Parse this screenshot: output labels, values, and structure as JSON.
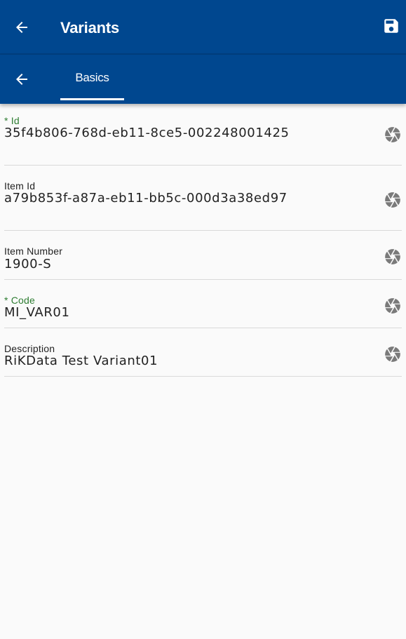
{
  "appbar": {
    "title": "Variants",
    "back_icon": "arrow-left-icon",
    "save_icon": "save-icon"
  },
  "tabbar": {
    "back_icon": "arrow-left-icon",
    "tabs": [
      {
        "label": "Basics",
        "active": true
      }
    ]
  },
  "fields": [
    {
      "label": "* Id",
      "required": true,
      "value": "35f4b806-768d-eb11-8ce5-002248001425",
      "icon": "camera-aperture-icon"
    },
    {
      "label": "Item Id",
      "required": false,
      "value": "a79b853f-a87a-eb11-bb5c-000d3a38ed97",
      "icon": "camera-aperture-icon"
    },
    {
      "label": "Item Number",
      "required": false,
      "value": "1900-S",
      "icon": "camera-aperture-icon"
    },
    {
      "label": "* Code",
      "required": true,
      "value": "MI_VAR01",
      "icon": "camera-aperture-icon"
    },
    {
      "label": "Description",
      "required": false,
      "value": "RiKData Test Variant01",
      "icon": "camera-aperture-icon"
    }
  ],
  "colors": {
    "primary": "#00478f",
    "required_label": "#2e7d32",
    "icon_gray": "#7a7a7a",
    "background": "#fafafa"
  }
}
